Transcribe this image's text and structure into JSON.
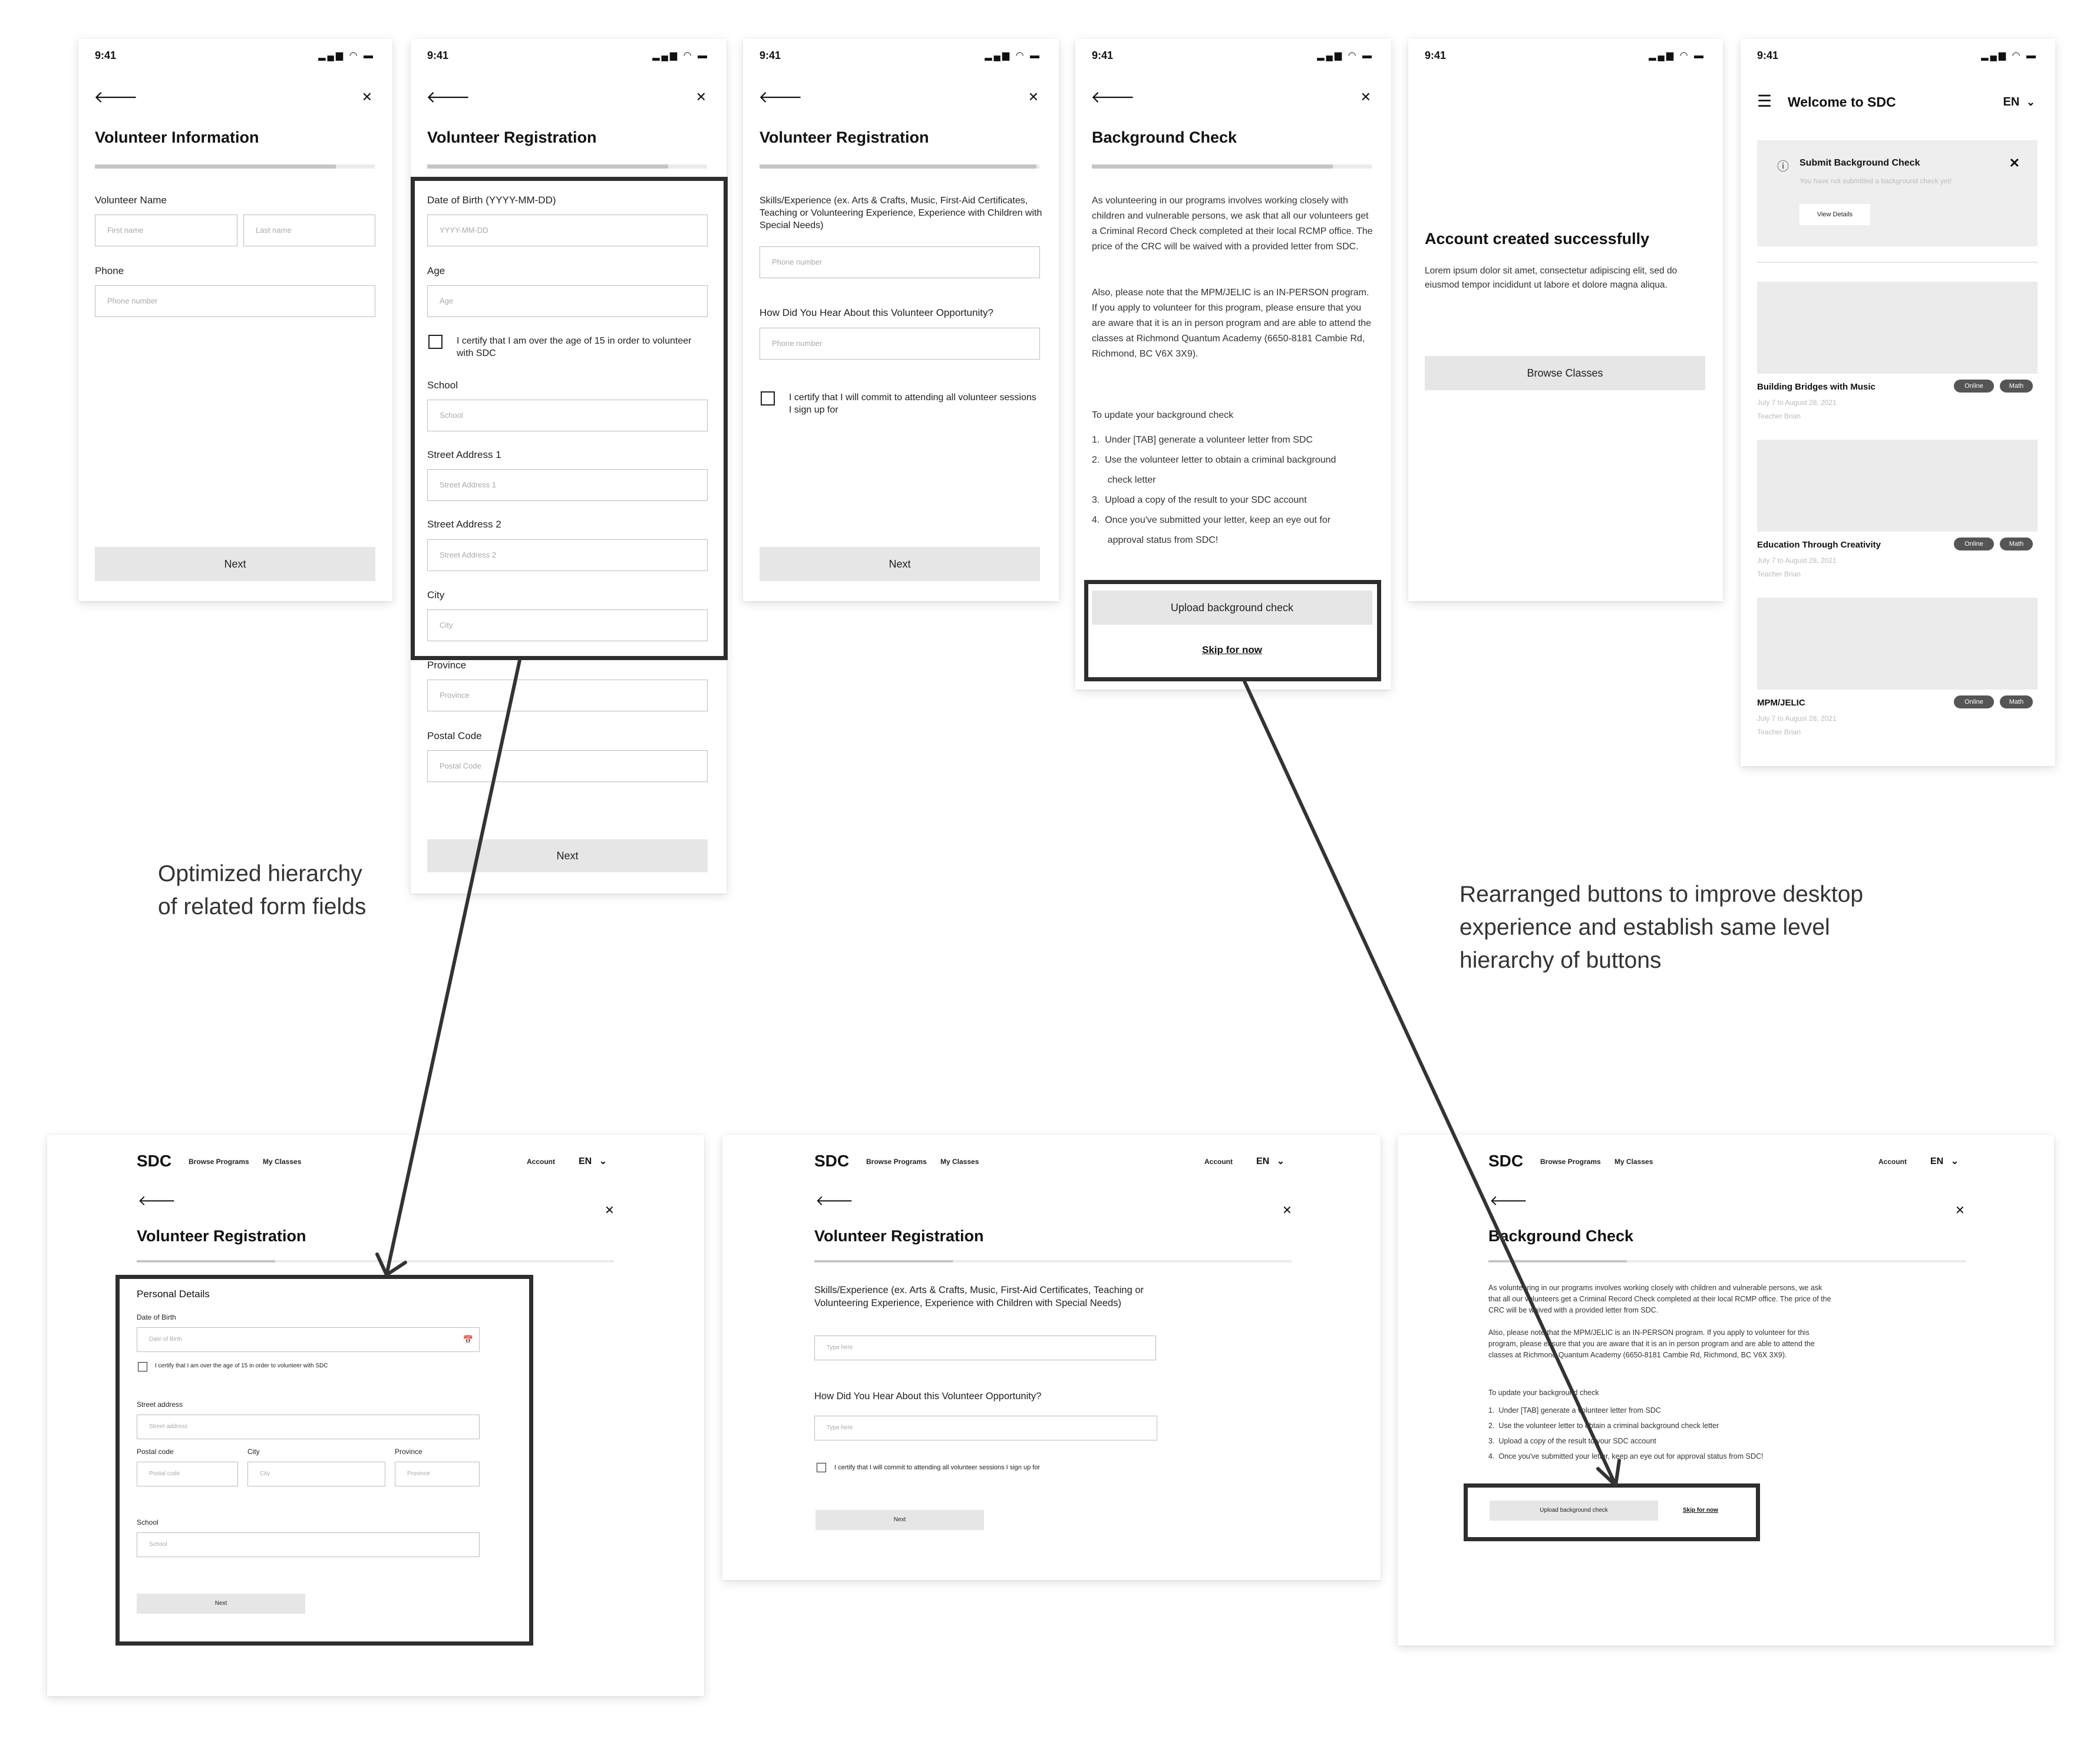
{
  "status_bar": {
    "time": "9:41",
    "icons": "▂▄▆ ◠ ▬"
  },
  "icons": {
    "back": "🡐",
    "close": "✕",
    "check": "✕",
    "menu": "☰",
    "info": "ⓘ",
    "calendar": "📅",
    "chevron": "⌄"
  },
  "m1": {
    "title": "Volunteer Information",
    "progress": 0.86,
    "name_label": "Volunteer Name",
    "first_placeholder": "First name",
    "last_placeholder": "Last name",
    "phone_label": "Phone",
    "phone_placeholder": "Phone number",
    "next": "Next"
  },
  "m2": {
    "title": "Volunteer Registration",
    "progress": 0.86,
    "fields": [
      {
        "label": "Date of Birth (YYYY-MM-DD)",
        "placeholder": "YYYY-MM-DD"
      },
      {
        "label": "Age",
        "placeholder": "Age"
      },
      {
        "label": "School",
        "placeholder": "School"
      },
      {
        "label": "Street Address 1",
        "placeholder": "Street Address 1"
      },
      {
        "label": "Street Address 2",
        "placeholder": "Street Address 2"
      },
      {
        "label": "City",
        "placeholder": "City"
      },
      {
        "label": "Province",
        "placeholder": "Province"
      },
      {
        "label": "Postal Code",
        "placeholder": "Postal Code"
      }
    ],
    "certify": "I certify that I am over the age of 15 in order to volunteer with SDC",
    "next": "Next"
  },
  "m3": {
    "title": "Volunteer Registration",
    "progress": 0.99,
    "skills_label": "Skills/Experience (ex. Arts & Crafts, Music, First-Aid Certificates, Teaching or Volunteering Experience, Experience with Children with Special Needs)",
    "skills_placeholder": "Phone number",
    "hear_label": "How Did You Hear About this Volunteer Opportunity?",
    "hear_placeholder": "Phone number",
    "certify": "I certify that I will commit to attending all volunteer sessions I sign up for",
    "next": "Next"
  },
  "m4": {
    "title": "Background Check",
    "progress": 0.86,
    "para1": "As volunteering in our programs involves working closely with children and vulnerable persons, we ask that all our volunteers get a Criminal Record Check completed at their local RCMP office. The price of the CRC will be waived with a provided letter from SDC.",
    "para2": "Also, please note that the MPM/JELIC is an IN-PERSON program. If you apply to volunteer for this program, please ensure that you are aware that it is an in person program and are able to attend the classes at Richmond Quantum Academy (6650-8181 Cambie Rd, Richmond, BC V6X 3X9).",
    "list_title": "To update your background check",
    "steps": [
      "1.  Under [TAB] generate a volunteer letter from SDC",
      "2.  Use the volunteer letter to obtain a criminal background",
      "      check letter",
      "3.  Upload a copy of the result to your SDC account",
      "4.  Once you've submitted your letter, keep an eye out for",
      "      approval status from SDC!"
    ],
    "upload": "Upload background check",
    "skip": "Skip for now"
  },
  "m5": {
    "title": "Account created successfully",
    "body": "Lorem ipsum dolor sit amet, consectetur adipiscing elit, sed do eiusmod tempor incididunt ut labore et dolore magna aliqua.",
    "button": "Browse Classes"
  },
  "m6": {
    "title": "Welcome to SDC",
    "lang": "EN",
    "notice_title": "Submit Background Check",
    "notice_sub": "You have not submitted a background check yet!",
    "notice_btn": "View Details",
    "cards": [
      {
        "title": "Building Bridges with Music",
        "date": "July 7 to August 28, 2021",
        "teacher": "Teacher Brian",
        "tags": [
          "Online",
          "Math"
        ]
      },
      {
        "title": "Education Through Creativity",
        "date": "July 7 to August 28, 2021",
        "teacher": "Teacher Brian",
        "tags": [
          "Online",
          "Math"
        ]
      },
      {
        "title": "MPM/JELIC",
        "date": "July 7 to August 28, 2021",
        "teacher": "Teacher Brian",
        "tags": [
          "Online",
          "Math"
        ]
      }
    ]
  },
  "annotations": {
    "a1": "Optimized hierarchy\nof related form fields",
    "a2": "Rearranged buttons to improve desktop\nexperience and establish same level\nhierarchy of buttons"
  },
  "desktop_nav": {
    "brand": "SDC",
    "browse": "Browse Programs",
    "classes": "My Classes",
    "account": "Account",
    "lang": "EN"
  },
  "d1": {
    "title": "Volunteer Registration",
    "progress": 0.29,
    "section": "Personal Details",
    "dob_label": "Date of Birth",
    "dob_placeholder": "Date of Birth",
    "certify": "I certify that I am over the age of 15 in order to volunteer with SDC",
    "street_label": "Street address",
    "street_placeholder": "Street address",
    "postal_label": "Postal code",
    "postal_placeholder": "Postal code",
    "city_label": "City",
    "city_placeholder": "City",
    "province_label": "Province",
    "province_placeholder": "Province",
    "school_label": "School",
    "school_placeholder": "School",
    "next": "Next"
  },
  "d2": {
    "title": "Volunteer Registration",
    "progress": 0.29,
    "skills_label": "Skills/Experience (ex. Arts & Crafts, Music, First-Aid Certificates, Teaching or Volunteering Experience, Experience with Children with Special Needs)",
    "skills_placeholder": "Type here",
    "hear_label": "How Did You Hear About this Volunteer Opportunity?",
    "hear_placeholder": "Type here",
    "certify": "I certify that I will commit to attending all volunteer sessions I sign up for",
    "next": "Next"
  },
  "d3": {
    "title": "Background Check",
    "progress": 0.29,
    "para1": "As volunteering in our programs involves working closely with children and vulnerable persons, we ask that all our volunteers get a Criminal Record Check completed at their local RCMP office. The price of the CRC will be waived with a provided letter from SDC.",
    "para2": "Also, please note that the MPM/JELIC is an IN-PERSON program. If you apply to volunteer for this program, please ensure that you are aware that it is an in person program and are able to attend the classes at Richmond Quantum Academy (6650-8181 Cambie Rd, Richmond, BC V6X 3X9).",
    "list_title": "To update your background check",
    "steps": [
      "1.  Under [TAB] generate a volunteer letter from SDC",
      "2.  Use the volunteer letter to obtain a criminal background check letter",
      "3.  Upload a copy of the result to your SDC account",
      "4.  Once you've submitted your letter, keep an eye out for approval status from SDC!"
    ],
    "upload": "Upload background check",
    "skip": "Skip for now"
  }
}
